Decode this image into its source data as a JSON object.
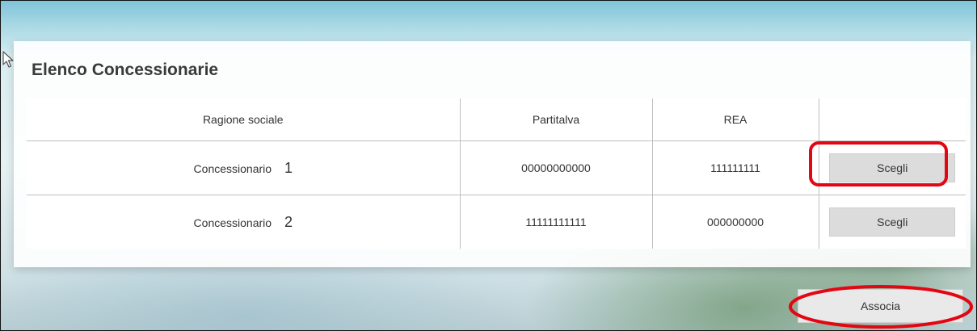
{
  "panel": {
    "title": "Elenco Concessionarie"
  },
  "table": {
    "columns": [
      "Ragione sociale",
      "Partitalva",
      "REA",
      ""
    ],
    "rows": [
      {
        "name": "Concessionario",
        "number": "1",
        "piva": "00000000000",
        "rea": "111111111",
        "action": "Scegli"
      },
      {
        "name": "Concessionario",
        "number": "2",
        "piva": "11111111111",
        "rea": "000000000",
        "action": "Scegli"
      }
    ]
  },
  "associa_label": "Associa",
  "annotation_color": "#e30613",
  "icons": {
    "cursor": "mouse-pointer-icon"
  }
}
